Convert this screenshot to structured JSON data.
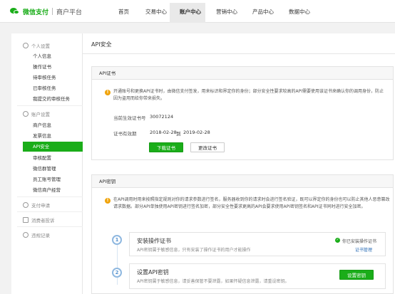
{
  "header": {
    "logo_text": "微信支付",
    "logo_sub": "商户平台",
    "nav": [
      {
        "label": "首页"
      },
      {
        "label": "交易中心"
      },
      {
        "label": "账户中心"
      },
      {
        "label": "营销中心"
      },
      {
        "label": "产品中心"
      },
      {
        "label": "数据中心"
      }
    ],
    "active_nav": "账户中心"
  },
  "sidebar": {
    "groups": [
      {
        "label": "个人设置",
        "icon": "user-icon",
        "items": [
          "个人信息",
          "操作证书",
          "待审核任务",
          "已审核任务",
          "我提交的审核任务"
        ]
      },
      {
        "label": "账户设置",
        "icon": "gear-icon",
        "items": [
          "商户信息",
          "发票信息",
          "API安全",
          "审核配置",
          "微信群管理",
          "员工账号管理",
          "微信商户经营"
        ]
      }
    ],
    "active_item": "API安全",
    "bottom": [
      {
        "label": "支付申请",
        "icon": "globe-icon"
      },
      {
        "label": "消费者投诉",
        "icon": "chat-icon"
      },
      {
        "label": "违规记录",
        "icon": "warning-icon"
      }
    ]
  },
  "main": {
    "title": "API安全",
    "cert_card": {
      "title": "API证书",
      "notice": "开通账号和更换API证书时，由微信支付签发，用来标识和界定你的身份；部分安全性要求较高的API需要使用该证书来确认你的调用身份，防止因为盗用而给你带来损失。",
      "serial_label": "当前生效证书号",
      "serial_value": "30072124",
      "validity_label": "证书有效期",
      "validity_start": "2018-02-28",
      "validity_to": "到",
      "validity_end": "2019-02-28",
      "download_btn": "下载证书",
      "change_btn": "更改证书"
    },
    "key_card": {
      "title": "API密钥",
      "notice": "在API调用时用来按照指定规则对你的请求参数进行签名，服务器收到你的请求时会进行签名验证，既可以界定你的身份也可以防止其他人恶意篡改请求数据。部分API单独使用API密钥进行签名加密，部分安全性要求更高的API会要求使用API密钥签名和API证书同时进行安全加密。",
      "steps": [
        {
          "num": "1",
          "title": "安装操作证书",
          "desc": "API密钥属于敏感信息，只有安装了操作证书的用户才能操作",
          "status": "你已安装操作证书",
          "link": "证书管理"
        },
        {
          "num": "2",
          "title": "设置API密钥",
          "desc": "API密钥属于敏感信息，请妥善保管不要泄露，如果怀疑信息泄露，请重设密钥。",
          "button": "设置密钥"
        }
      ]
    }
  }
}
